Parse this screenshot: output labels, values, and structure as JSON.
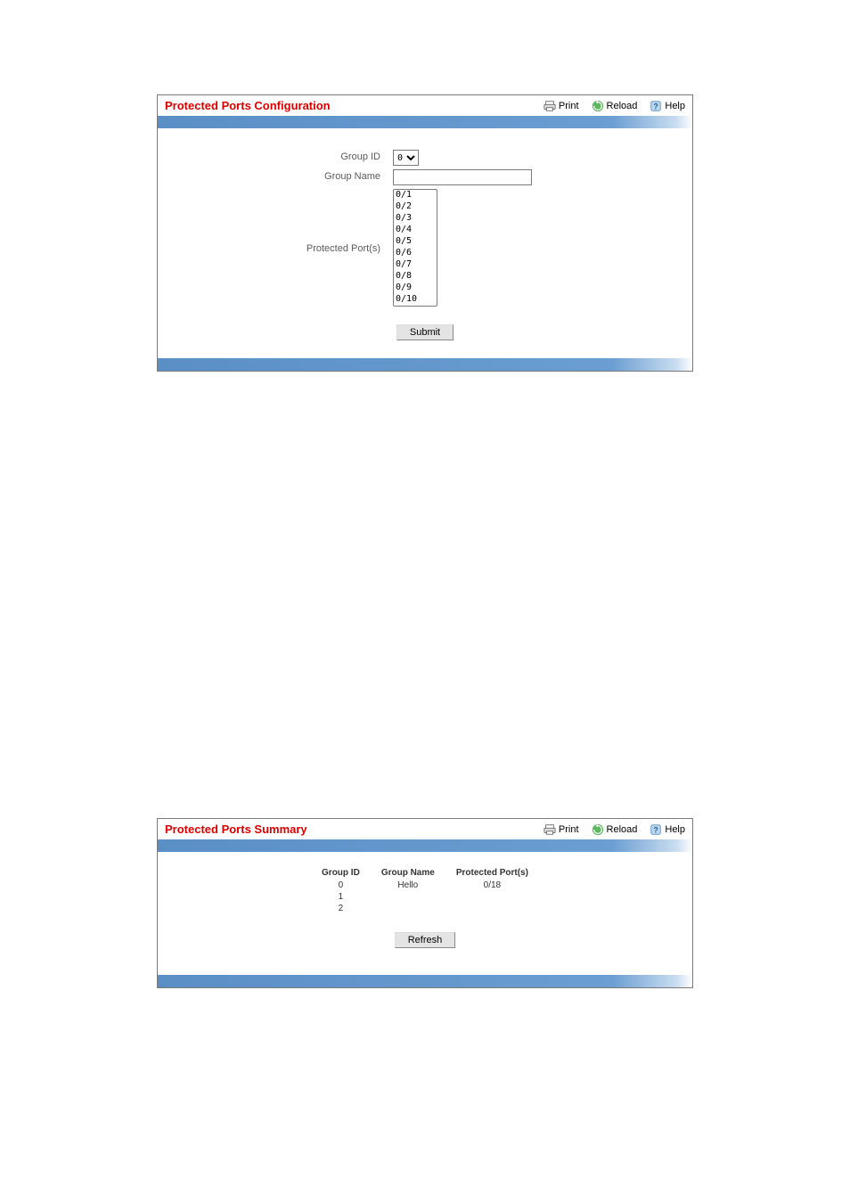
{
  "toolbar": {
    "print_label": "Print",
    "reload_label": "Reload",
    "help_label": "Help"
  },
  "config": {
    "title": "Protected Ports Configuration",
    "labels": {
      "group_id": "Group ID",
      "group_name": "Group Name",
      "protected_ports": "Protected Port(s)"
    },
    "group_id_options": [
      "0"
    ],
    "group_id_selected": "0",
    "group_name_value": "",
    "port_options": [
      "0/1",
      "0/2",
      "0/3",
      "0/4",
      "0/5",
      "0/6",
      "0/7",
      "0/8",
      "0/9",
      "0/10"
    ],
    "submit_label": "Submit"
  },
  "summary": {
    "title": "Protected Ports Summary",
    "columns": [
      "Group ID",
      "Group Name",
      "Protected Port(s)"
    ],
    "rows": [
      {
        "group_id": "0",
        "group_name": "Hello",
        "ports": "0/18"
      },
      {
        "group_id": "1",
        "group_name": "",
        "ports": ""
      },
      {
        "group_id": "2",
        "group_name": "",
        "ports": ""
      }
    ],
    "refresh_label": "Refresh"
  }
}
